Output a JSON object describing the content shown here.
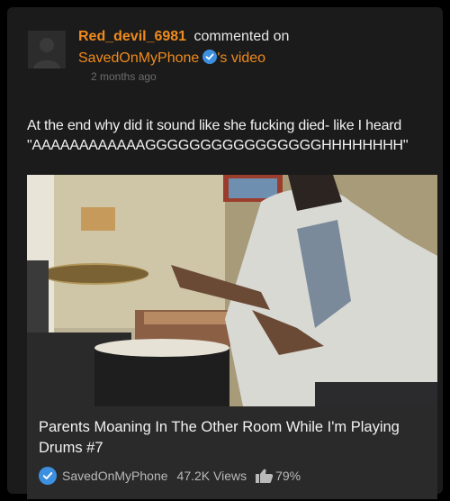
{
  "activity": {
    "username": "Red_devil_6981",
    "action": "commented on",
    "channel": "SavedOnMyPhone",
    "possessive": "'s video",
    "timestamp": "2 months ago"
  },
  "comment": {
    "line1": "At the end why did it sound like she fucking died- like I heard",
    "line2": "\"AAAAAAAAAAAAGGGGGGGGGGGGGGGGHHHHHHHH\""
  },
  "video": {
    "title": "Parents Moaning In The Other Room While I'm Playing Drums #7",
    "channel": "SavedOnMyPhone",
    "views": "47.2K Views",
    "rating": "79%"
  },
  "colors": {
    "accent": "#f08a1c",
    "verified": "#3d8fe0",
    "background": "#000000",
    "card": "#1b1b1b"
  },
  "icons": [
    "avatar-placeholder-icon",
    "verified-badge-icon",
    "thumbs-up-icon"
  ]
}
